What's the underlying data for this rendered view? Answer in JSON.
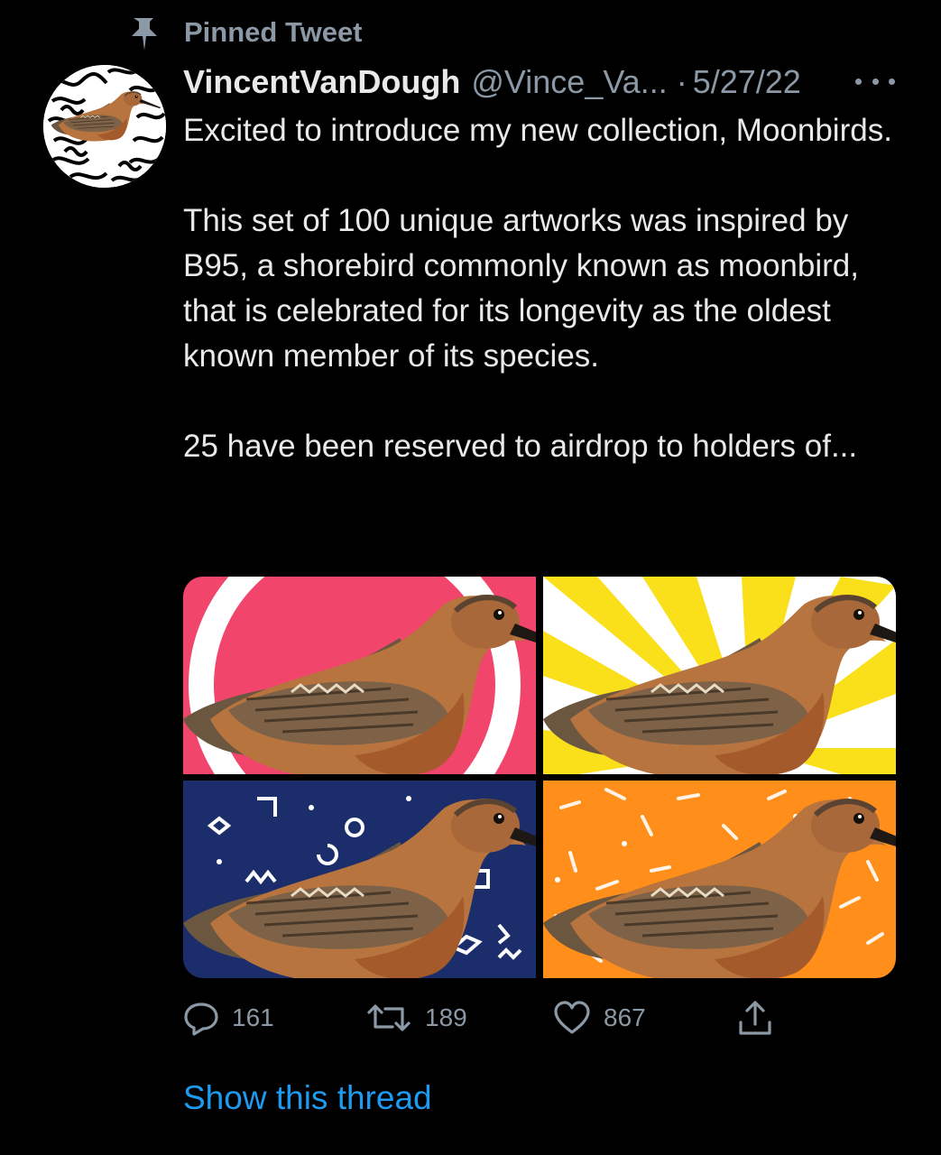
{
  "pinned": {
    "label": "Pinned Tweet",
    "icon": "pin-icon"
  },
  "tweet": {
    "display_name": "VincentVanDough",
    "handle": "@Vince_Va...",
    "separator": "·",
    "date": "5/27/22",
    "more_icon": "more-icon",
    "paragraphs": [
      "Excited to introduce my new collection, Moonbirds.",
      "This set of 100 unique artworks was inspired by B95, a shorebird commonly known as moonbird, that is celebrated for its longevity as the oldest known member of its species.",
      "25 have been reserved to airdrop to holders of..."
    ],
    "media": [
      {
        "background": "pink-ring",
        "color": "#f2456c"
      },
      {
        "background": "yellow-rays",
        "color": "#f9e01a"
      },
      {
        "background": "navy-shapes",
        "color": "#1c2d6b"
      },
      {
        "background": "orange-dashes",
        "color": "#ff8e1a"
      }
    ]
  },
  "actions": {
    "reply": {
      "icon": "reply-icon",
      "count": "161"
    },
    "retweet": {
      "icon": "retweet-icon",
      "count": "189"
    },
    "like": {
      "icon": "heart-icon",
      "count": "867"
    },
    "share": {
      "icon": "share-icon"
    }
  },
  "show_thread": "Show this thread",
  "colors": {
    "background": "#000000",
    "text": "#e7e9ea",
    "muted": "#8b98a5",
    "link": "#1d9bf0"
  }
}
